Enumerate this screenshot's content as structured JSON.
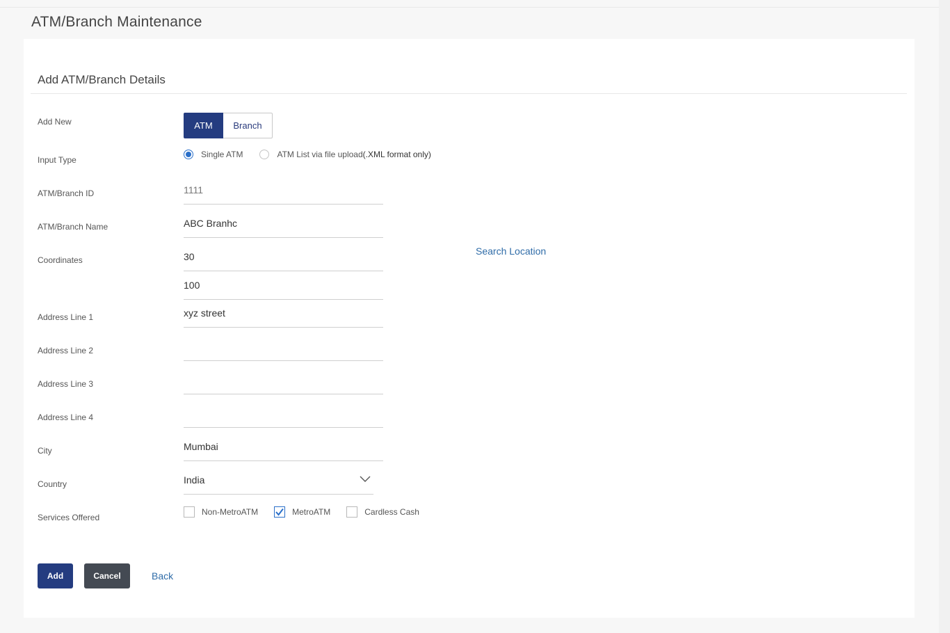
{
  "page": {
    "title": "ATM/Branch Maintenance"
  },
  "form": {
    "section_title": "Add ATM/Branch Details",
    "add_new": {
      "label": "Add New",
      "options": [
        "ATM",
        "Branch"
      ],
      "selected": "ATM"
    },
    "input_type": {
      "label": "Input Type",
      "options": [
        {
          "label": "Single ATM",
          "checked": true
        },
        {
          "label": "ATM List via file upload",
          "note": "(.XML format only)",
          "checked": false
        }
      ]
    },
    "atm_branch_id": {
      "label": "ATM/Branch ID",
      "value": "1111"
    },
    "atm_branch_name": {
      "label": "ATM/Branch Name",
      "value": "ABC Branhc"
    },
    "coordinates": {
      "label": "Coordinates",
      "latitude": "30",
      "longitude": "100",
      "search_link": "Search Location"
    },
    "address_line_1": {
      "label": "Address Line 1",
      "value": "xyz street"
    },
    "address_line_2": {
      "label": "Address Line 2",
      "value": ""
    },
    "address_line_3": {
      "label": "Address Line 3",
      "value": ""
    },
    "address_line_4": {
      "label": "Address Line 4",
      "value": ""
    },
    "city": {
      "label": "City",
      "value": "Mumbai"
    },
    "country": {
      "label": "Country",
      "value": "India"
    },
    "services": {
      "label": "Services Offered",
      "options": [
        {
          "label": "Non-MetroATM",
          "checked": false
        },
        {
          "label": "MetroATM",
          "checked": true
        },
        {
          "label": "Cardless Cash",
          "checked": false
        }
      ]
    }
  },
  "actions": {
    "add": "Add",
    "cancel": "Cancel",
    "back": "Back"
  },
  "colors": {
    "primary": "#243c80",
    "secondary": "#444a53",
    "link": "#2f6ca8",
    "accent": "#2a6fc9"
  }
}
